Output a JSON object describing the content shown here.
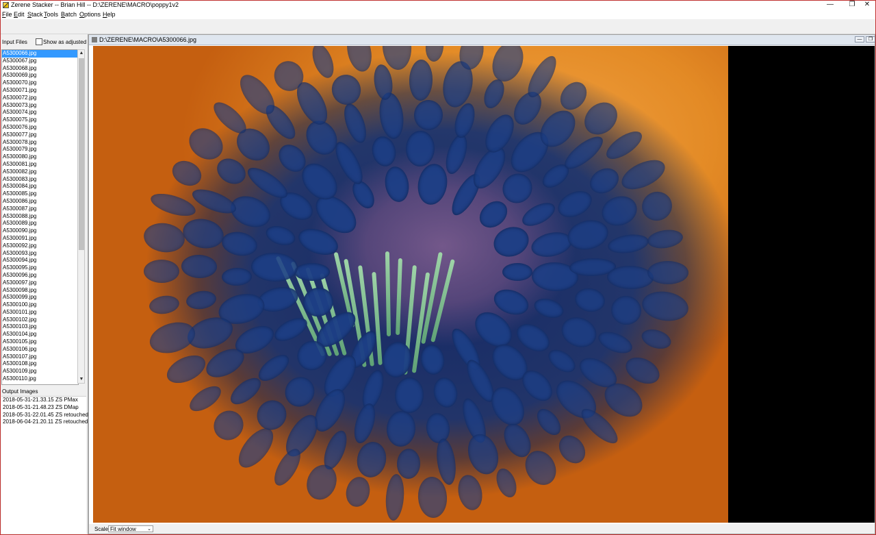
{
  "window": {
    "title": "Zerene Stacker -- Brian Hill -- D:\\ZERENE\\MACRO\\poppy1v2",
    "min_glyph": "—",
    "max_glyph": "❐",
    "close_glyph": "✕"
  },
  "menu": [
    {
      "key": "F",
      "rest": "ile"
    },
    {
      "key": "E",
      "rest": "dit"
    },
    {
      "key": "S",
      "rest": "tack"
    },
    {
      "key": "T",
      "rest": "ools"
    },
    {
      "key": "B",
      "rest": "atch"
    },
    {
      "key": "O",
      "rest": "ptions"
    },
    {
      "key": "H",
      "rest": "elp"
    }
  ],
  "left_panel": {
    "input_files_label": "Input Files",
    "show_adjusted_label": "Show as adjusted",
    "show_adjusted_checked": false,
    "files": [
      "A5300066.jpg",
      "A5300067.jpg",
      "A5300068.jpg",
      "A5300069.jpg",
      "A5300070.jpg",
      "A5300071.jpg",
      "A5300072.jpg",
      "A5300073.jpg",
      "A5300074.jpg",
      "A5300075.jpg",
      "A5300076.jpg",
      "A5300077.jpg",
      "A5300078.jpg",
      "A5300079.jpg",
      "A5300080.jpg",
      "A5300081.jpg",
      "A5300082.jpg",
      "A5300083.jpg",
      "A5300084.jpg",
      "A5300085.jpg",
      "A5300086.jpg",
      "A5300087.jpg",
      "A5300088.jpg",
      "A5300089.jpg",
      "A5300090.jpg",
      "A5300091.jpg",
      "A5300092.jpg",
      "A5300093.jpg",
      "A5300094.jpg",
      "A5300095.jpg",
      "A5300096.jpg",
      "A5300097.jpg",
      "A5300098.jpg",
      "A5300099.jpg",
      "A5300100.jpg",
      "A5300101.jpg",
      "A5300102.jpg",
      "A5300103.jpg",
      "A5300104.jpg",
      "A5300105.jpg",
      "A5300106.jpg",
      "A5300107.jpg",
      "A5300108.jpg",
      "A5300109.jpg",
      "A5300110.jpg"
    ],
    "selected_file": "A5300066.jpg",
    "output_images_label": "Output Images",
    "outputs": [
      "2018-05-31-21.33.15 ZS PMax",
      "2018-05-31-21.48.23 ZS DMap",
      "2018-05-31-22.01.45 ZS retouched",
      "2018-06-04-21.20.11 ZS retouched"
    ]
  },
  "image_frame": {
    "title": "D:\\ZERENE\\MACRO\\A5300066.jpg",
    "scale_label": "Scale",
    "scale_value": "Fit window"
  },
  "colors": {
    "selection": "#3399ff",
    "frame_title_bg": "#dfe6ef",
    "window_border": "#c0302e"
  }
}
